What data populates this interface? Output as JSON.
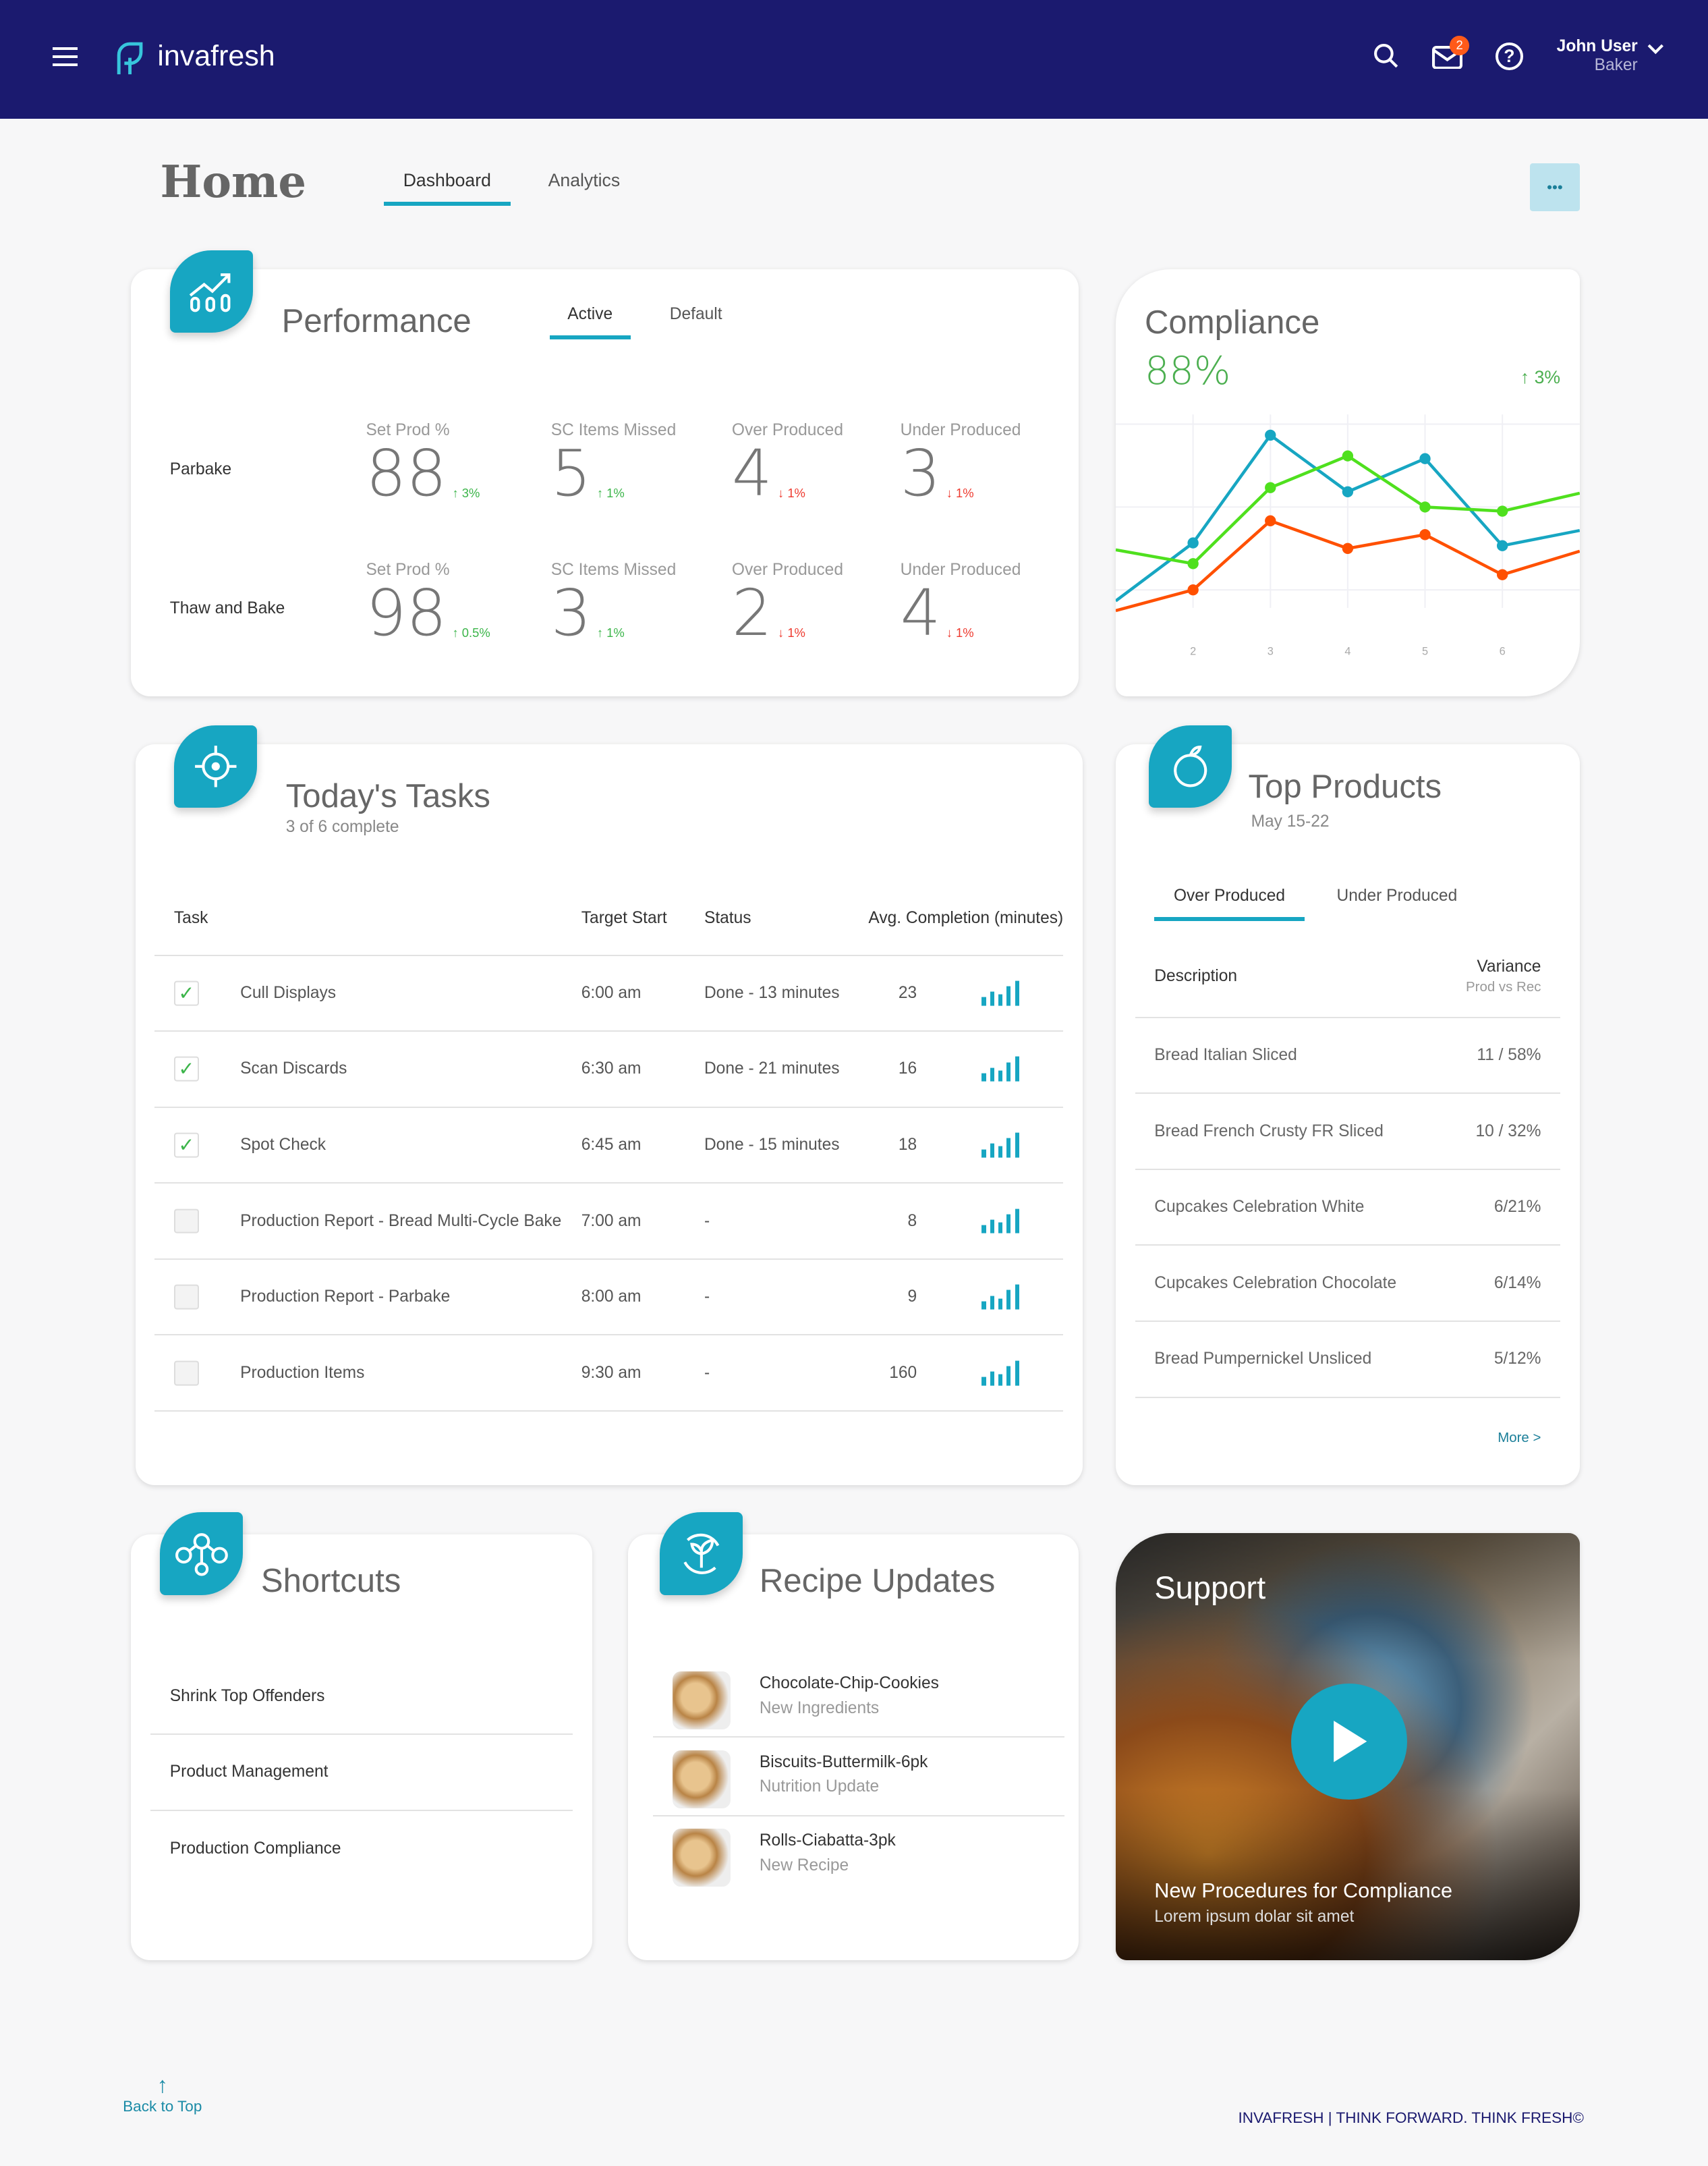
{
  "header": {
    "brand": "invafresh",
    "user_name": "John User",
    "user_role": "Baker",
    "mail_badge": "2",
    "icons": [
      "menu-icon",
      "search-icon",
      "mail-icon",
      "help-icon",
      "chevron-down-icon"
    ]
  },
  "page": {
    "title": "Home",
    "tabs": [
      {
        "label": "Dashboard",
        "active": true
      },
      {
        "label": "Analytics",
        "active": false
      }
    ],
    "more_label": "•••"
  },
  "performance": {
    "title": "Performance",
    "tabs": [
      {
        "label": "Active",
        "active": true
      },
      {
        "label": "Default",
        "active": false
      }
    ],
    "rows": [
      {
        "name": "Parbake",
        "metrics": [
          {
            "label": "Set Prod %",
            "value": "88",
            "change": "3%",
            "dir": "up"
          },
          {
            "label": "SC Items Missed",
            "value": "5",
            "change": "1%",
            "dir": "up"
          },
          {
            "label": "Over Produced",
            "value": "4",
            "change": "1%",
            "dir": "down"
          },
          {
            "label": "Under Produced",
            "value": "3",
            "change": "1%",
            "dir": "down"
          }
        ]
      },
      {
        "name": "Thaw and Bake",
        "metrics": [
          {
            "label": "Set Prod %",
            "value": "98",
            "change": "0.5%",
            "dir": "up"
          },
          {
            "label": "SC Items Missed",
            "value": "3",
            "change": "1%",
            "dir": "up"
          },
          {
            "label": "Over Produced",
            "value": "2",
            "change": "1%",
            "dir": "down"
          },
          {
            "label": "Under Produced",
            "value": "4",
            "change": "1%",
            "dir": "down"
          }
        ]
      }
    ]
  },
  "compliance": {
    "title": "Compliance",
    "value": "88%",
    "change": "3%"
  },
  "chart_data": {
    "type": "line",
    "x": [
      1,
      2,
      3,
      4,
      5,
      6,
      7
    ],
    "xticks": [
      "2",
      "3",
      "4",
      "5",
      "6"
    ],
    "ylim": [
      0,
      160
    ],
    "grid": true,
    "series": [
      {
        "color": "#17a6c2",
        "values": [
          25,
          67,
          145,
          104,
          128,
          65,
          76
        ]
      },
      {
        "color": "#4fe01e",
        "values": [
          62,
          52,
          107,
          130,
          93,
          90,
          103
        ]
      },
      {
        "color": "#ff5000",
        "values": [
          18,
          33,
          83,
          63,
          73,
          44,
          61
        ]
      }
    ]
  },
  "tasks": {
    "title": "Today's Tasks",
    "subtitle": "3 of 6 complete",
    "headers": [
      "Task",
      "Target Start",
      "Status",
      "Avg. Completion (minutes)"
    ],
    "rows": [
      {
        "done": true,
        "task": "Cull Displays",
        "start": "6:00 am",
        "status": "Done - 13 minutes",
        "avg": "23"
      },
      {
        "done": true,
        "task": "Scan Discards",
        "start": "6:30 am",
        "status": "Done - 21 minutes",
        "avg": "16"
      },
      {
        "done": true,
        "task": "Spot Check",
        "start": "6:45 am",
        "status": "Done - 15 minutes",
        "avg": "18"
      },
      {
        "done": false,
        "task": "Production Report - Bread Multi-Cycle Bake",
        "start": "7:00 am",
        "status": "-",
        "avg": "8"
      },
      {
        "done": false,
        "task": "Production Report - Parbake",
        "start": "8:00 am",
        "status": "-",
        "avg": "9"
      },
      {
        "done": false,
        "task": "Production Items",
        "start": "9:30 am",
        "status": "-",
        "avg": "160"
      }
    ]
  },
  "top_products": {
    "title": "Top Products",
    "subtitle": "May 15-22",
    "tabs": [
      {
        "label": "Over Produced",
        "active": true
      },
      {
        "label": "Under Produced",
        "active": false
      }
    ],
    "col_desc": "Description",
    "col_var": "Variance",
    "col_var_sub": "Prod vs Rec",
    "rows": [
      {
        "name": "Bread Italian Sliced",
        "variance": "11 / 58%"
      },
      {
        "name": "Bread French Crusty FR Sliced",
        "variance": "10 / 32%"
      },
      {
        "name": "Cupcakes Celebration White",
        "variance": "6/21%"
      },
      {
        "name": "Cupcakes Celebration Chocolate",
        "variance": "6/14%"
      },
      {
        "name": "Bread Pumpernickel Unsliced",
        "variance": "5/12%"
      }
    ],
    "more": "More >"
  },
  "shortcuts": {
    "title": "Shortcuts",
    "items": [
      "Shrink Top Offenders",
      "Product Management",
      "Production Compliance"
    ]
  },
  "recipes": {
    "title": "Recipe Updates",
    "items": [
      {
        "name": "Chocolate-Chip-Cookies",
        "note": "New Ingredients"
      },
      {
        "name": "Biscuits-Buttermilk-6pk",
        "note": "Nutrition Update"
      },
      {
        "name": "Rolls-Ciabatta-3pk",
        "note": "New Recipe"
      }
    ]
  },
  "support": {
    "title": "Support",
    "video_title": "New Procedures for Compliance",
    "video_sub": "Lorem ipsum dolar sit amet"
  },
  "footer": {
    "back": "Back to Top",
    "tagline": "INVAFRESH | THINK FORWARD. THINK FRESH©"
  },
  "colors": {
    "header": "#1b1a6f",
    "accent": "#17a6c2",
    "up": "#3cb54a",
    "down": "#ee3b30"
  }
}
